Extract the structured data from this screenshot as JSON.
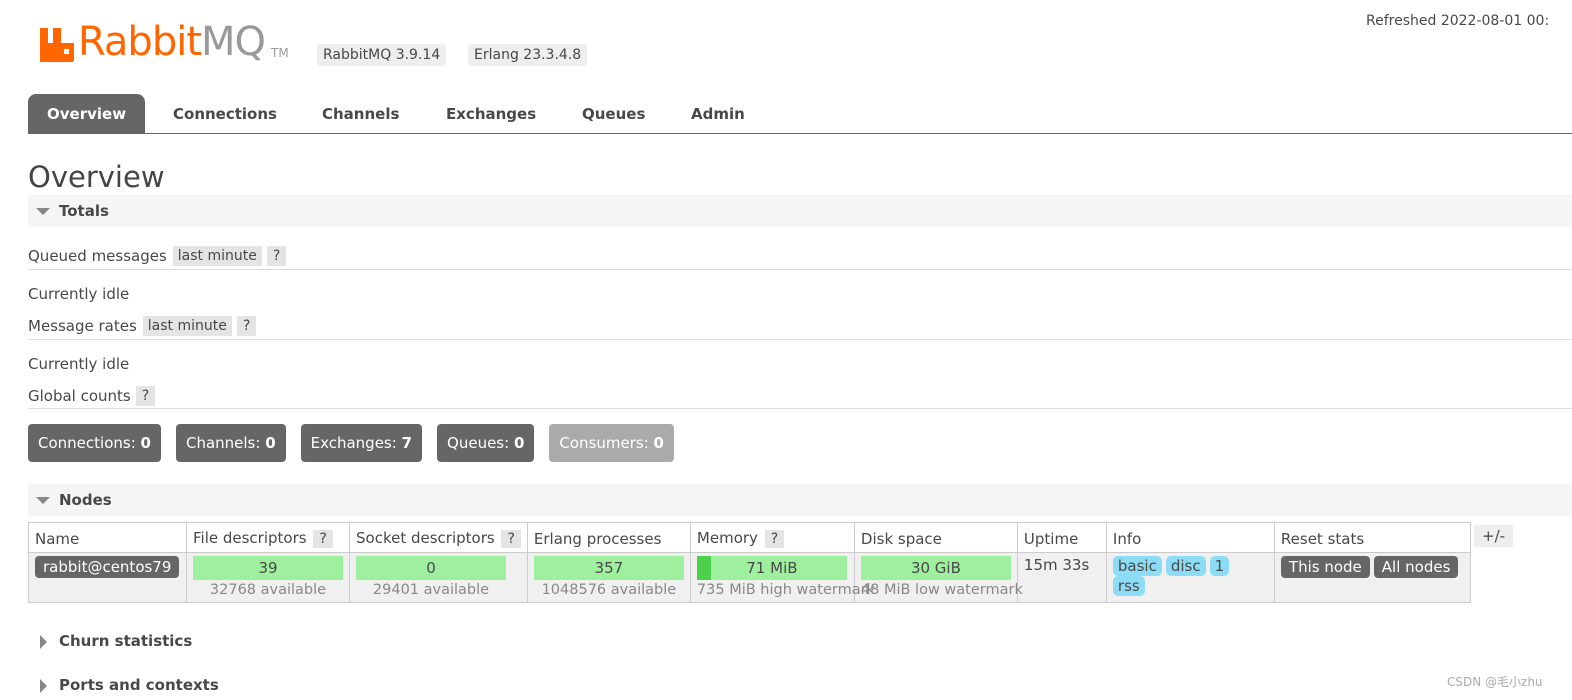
{
  "header": {
    "logo_rabbit": "Rabbit",
    "logo_mq": "MQ",
    "logo_tm": "TM",
    "rabbitmq_version": "RabbitMQ 3.9.14",
    "erlang_version": "Erlang 23.3.4.8",
    "refreshed": "Refreshed 2022-08-01 00:"
  },
  "tabs": [
    {
      "label": "Overview",
      "active": true
    },
    {
      "label": "Connections"
    },
    {
      "label": "Channels"
    },
    {
      "label": "Exchanges"
    },
    {
      "label": "Queues"
    },
    {
      "label": "Admin"
    }
  ],
  "page_title": "Overview",
  "totals": {
    "heading": "Totals",
    "queued_messages_label": "Queued messages",
    "queued_messages_range": "last minute",
    "help": "?",
    "queued_status": "Currently idle",
    "message_rates_label": "Message rates",
    "message_rates_range": "last minute",
    "rates_status": "Currently idle",
    "global_counts_label": "Global counts"
  },
  "counts": [
    {
      "label": "Connections:",
      "value": "0"
    },
    {
      "label": "Channels:",
      "value": "0"
    },
    {
      "label": "Exchanges:",
      "value": "7"
    },
    {
      "label": "Queues:",
      "value": "0"
    },
    {
      "label": "Consumers:",
      "value": "0"
    }
  ],
  "nodes": {
    "heading": "Nodes",
    "columns": [
      "Name",
      "File descriptors",
      "Socket descriptors",
      "Erlang processes",
      "Memory",
      "Disk space",
      "Uptime",
      "Info",
      "Reset stats"
    ],
    "toggle": "+/-",
    "row": {
      "name": "rabbit@centos79",
      "file_descriptors": "39",
      "file_descriptors_available": "32768 available",
      "socket_descriptors": "0",
      "socket_descriptors_available": "29401 available",
      "erlang_processes": "357",
      "erlang_processes_available": "1048576 available",
      "memory": "71 MiB",
      "memory_used_fraction": 0.097,
      "memory_watermark": "735 MiB high watermark",
      "disk_space": "30 GiB",
      "disk_watermark": "48 MiB low watermark",
      "uptime": "15m 33s",
      "info": [
        "basic",
        "disc",
        "1",
        "rss"
      ],
      "reset_this_node": "This node",
      "reset_all_nodes": "All nodes"
    }
  },
  "collapsed_sections": [
    "Churn statistics",
    "Ports and contexts"
  ],
  "watermark": "CSDN @毛小zhu",
  "colors": {
    "brand_orange": "#ff6600",
    "tab_active": "#666666",
    "bar_green": "#9ef09e",
    "info_blue": "#8ddcf6"
  }
}
